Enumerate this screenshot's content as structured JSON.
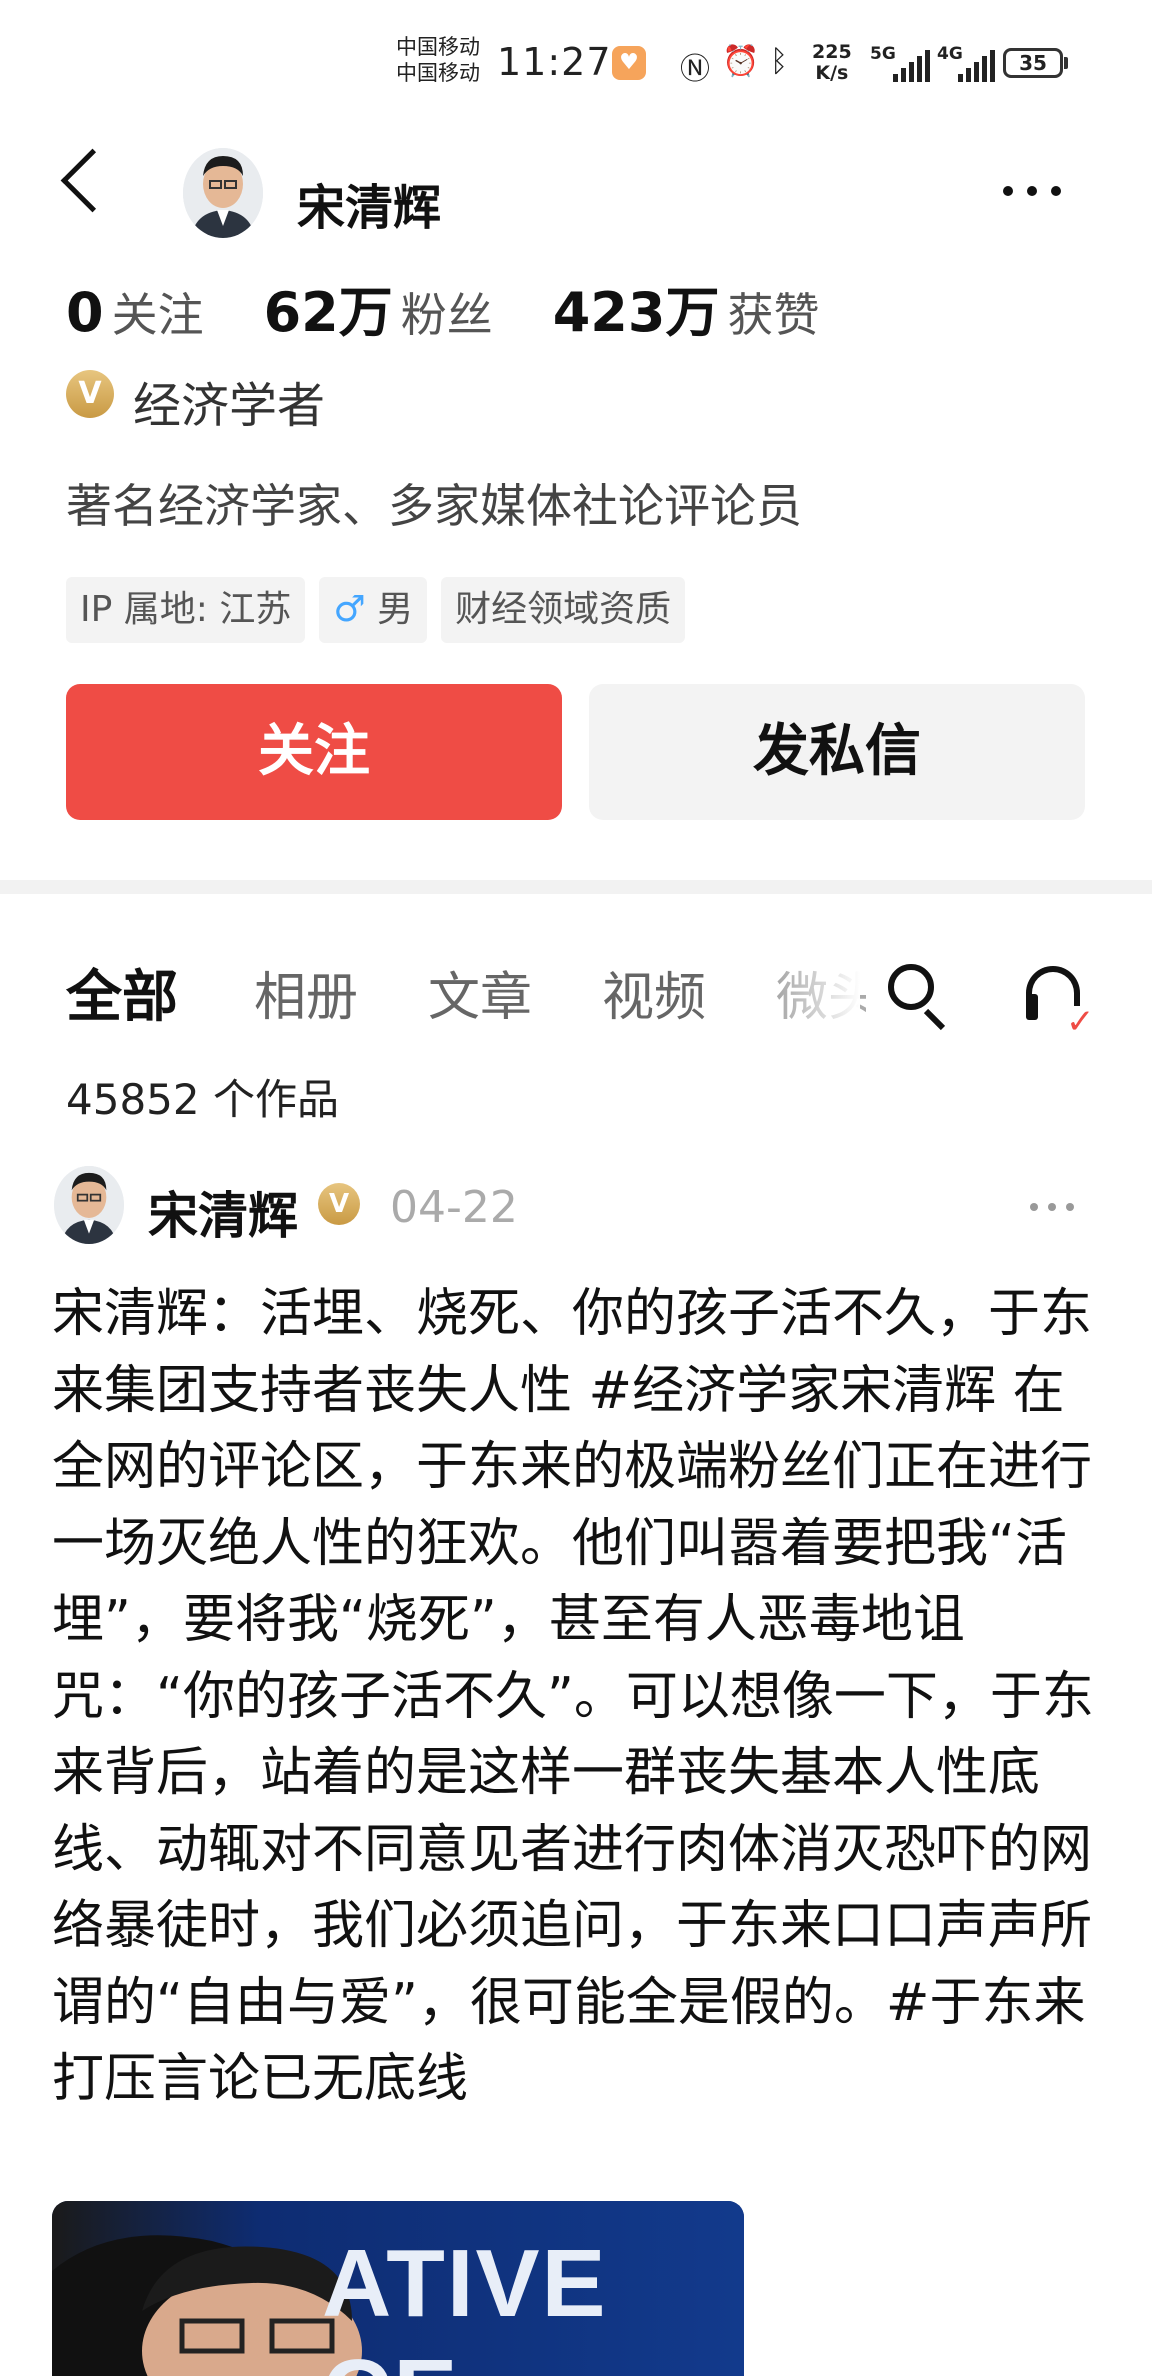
{
  "status_bar": {
    "carrier1": "中国移动",
    "carrier2": "中国移动",
    "time": "11:27",
    "speed_value": "225",
    "speed_unit": "K/s",
    "net1": "5G",
    "net2": "4G",
    "battery": "35"
  },
  "header": {
    "name": "宋清辉"
  },
  "stats": {
    "following_count": "0",
    "following_label": "关注",
    "fans_count": "62万",
    "fans_label": "粉丝",
    "likes_count": "423万",
    "likes_label": "获赞"
  },
  "profile": {
    "verified_badge": "V",
    "title": "经济学者",
    "bio": "著名经济学家、多家媒体社论评论员",
    "tags": [
      "IP 属地: 江苏",
      "男",
      "财经领域资质"
    ],
    "gender_symbol": "♂"
  },
  "actions": {
    "follow": "关注",
    "message": "发私信"
  },
  "tabs": [
    "全部",
    "相册",
    "文章",
    "视频",
    "微头"
  ],
  "works_count": "45852 个作品",
  "post": {
    "author": "宋清辉",
    "date": "04-22",
    "body": "宋清辉：活埋、烧死、你的孩子活不久，于东来集团支持者丧失人性 #经济学家宋清辉 在全网的评论区，于东来的极端粉丝们正在进行一场灭绝人性的狂欢。他们叫嚣着要把我“活埋”，要将我“烧死”，甚至有人恶毒地诅咒：“你的孩子活不久”。可以想像一下，于东来背后，站着的是这样一群丧失基本人性底线、动辄对不同意见者进行肉体消灭恐吓的网络暴徒时，我们必须追问，于东来口口声声所谓的“自由与爱”，很可能全是假的。#于东来打压言论已无底线",
    "image_text": "ATIVE CE"
  },
  "colors": {
    "accent": "#ef4c45",
    "badge_gold": "#d9b062"
  }
}
